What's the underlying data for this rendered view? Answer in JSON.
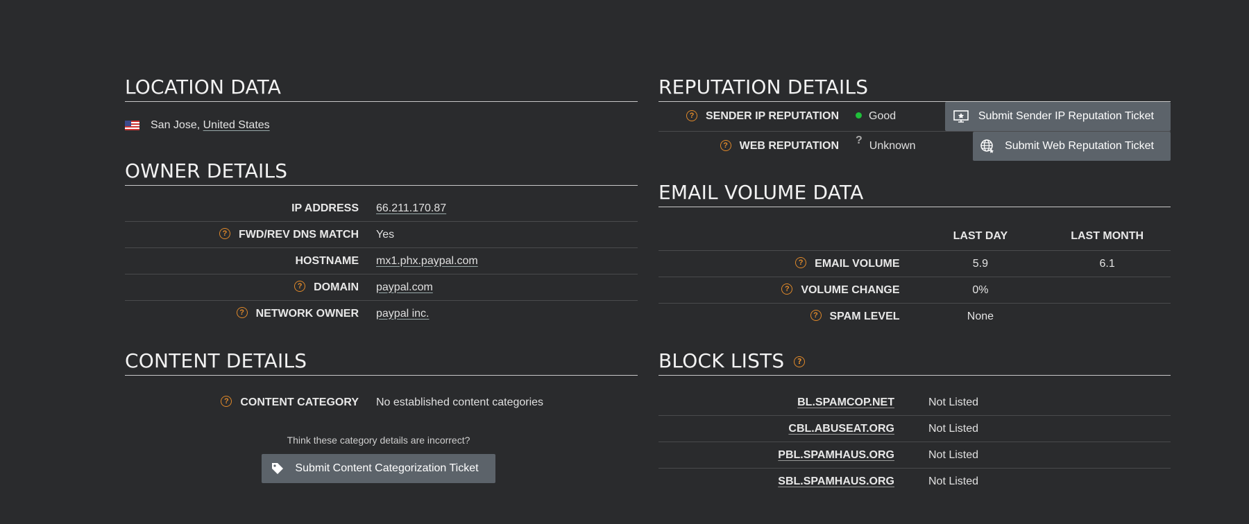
{
  "location": {
    "title": "LOCATION DATA",
    "city": "San Jose,",
    "country": "United States"
  },
  "owner": {
    "title": "OWNER DETAILS",
    "rows": [
      {
        "label": "IP ADDRESS",
        "value": "66.211.170.87"
      },
      {
        "label": "FWD/REV DNS MATCH",
        "value": "Yes"
      },
      {
        "label": "HOSTNAME",
        "value": "mx1.phx.paypal.com"
      },
      {
        "label": "DOMAIN",
        "value": "paypal.com"
      },
      {
        "label": "NETWORK OWNER",
        "value": "paypal inc."
      }
    ]
  },
  "content": {
    "title": "CONTENT DETAILS",
    "label": "CONTENT CATEGORY",
    "value": "No established content categories",
    "note": "Think these category details are incorrect?",
    "button": "Submit Content Categorization Ticket"
  },
  "reputation": {
    "title": "REPUTATION DETAILS",
    "sender_label": "SENDER IP REPUTATION",
    "sender_value": "Good",
    "sender_button": "Submit Sender IP Reputation Ticket",
    "web_label": "WEB REPUTATION",
    "web_value": "Unknown",
    "web_button": "Submit Web Reputation Ticket",
    "good_color": "#1fbf3a"
  },
  "email_volume": {
    "title": "EMAIL VOLUME DATA",
    "col_day": "LAST DAY",
    "col_month": "LAST MONTH",
    "rows": [
      {
        "label": "EMAIL VOLUME",
        "day": "5.9",
        "month": "6.1"
      },
      {
        "label": "VOLUME CHANGE",
        "day": "0%",
        "month": ""
      },
      {
        "label": "SPAM LEVEL",
        "day": "None",
        "month": ""
      }
    ]
  },
  "block_lists": {
    "title": "BLOCK LISTS",
    "rows": [
      {
        "label": "BL.SPAMCOP.NET",
        "value": "Not Listed"
      },
      {
        "label": "CBL.ABUSEAT.ORG",
        "value": "Not Listed"
      },
      {
        "label": "PBL.SPAMHAUS.ORG",
        "value": "Not Listed"
      },
      {
        "label": "SBL.SPAMHAUS.ORG",
        "value": "Not Listed"
      }
    ]
  },
  "icons": {
    "help": "?",
    "unknown": "?",
    "accent_color": "#e0892a"
  }
}
